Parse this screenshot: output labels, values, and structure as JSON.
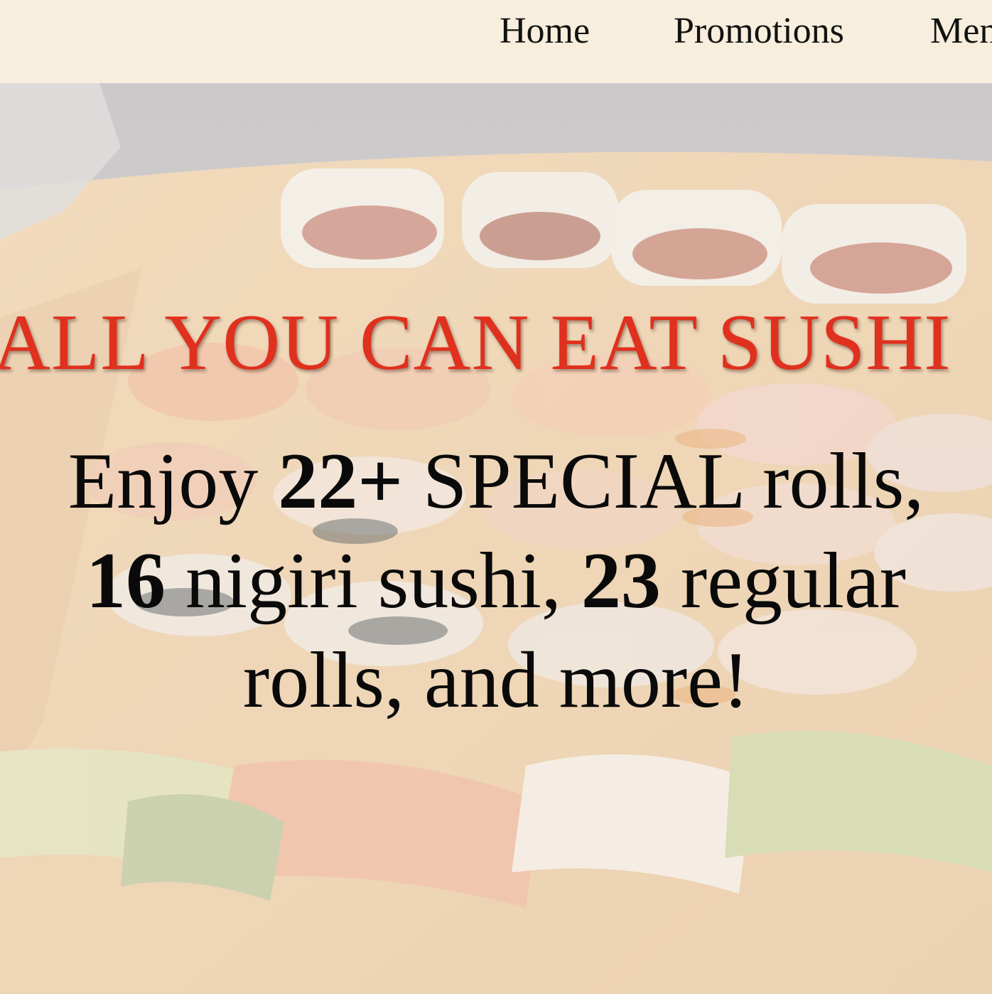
{
  "nav": {
    "links": [
      {
        "label": "Home"
      },
      {
        "label": "Promotions"
      },
      {
        "label": "Menu"
      }
    ]
  },
  "hero": {
    "title": "ALL YOU CAN EAT SUSHI",
    "lines": {
      "enjoy": "Enjoy ",
      "special_count": "22+",
      "special_rest": " SPECIAL rolls,",
      "nigiri_count": "16",
      "nigiri_rest": " nigiri sushi, ",
      "regular_count": "23",
      "regular_rest": " regular",
      "final": "rolls, and more!"
    }
  },
  "colors": {
    "nav_background": "#f8eedd",
    "title": "#e0301e",
    "body_text": "#0a0a0a"
  }
}
